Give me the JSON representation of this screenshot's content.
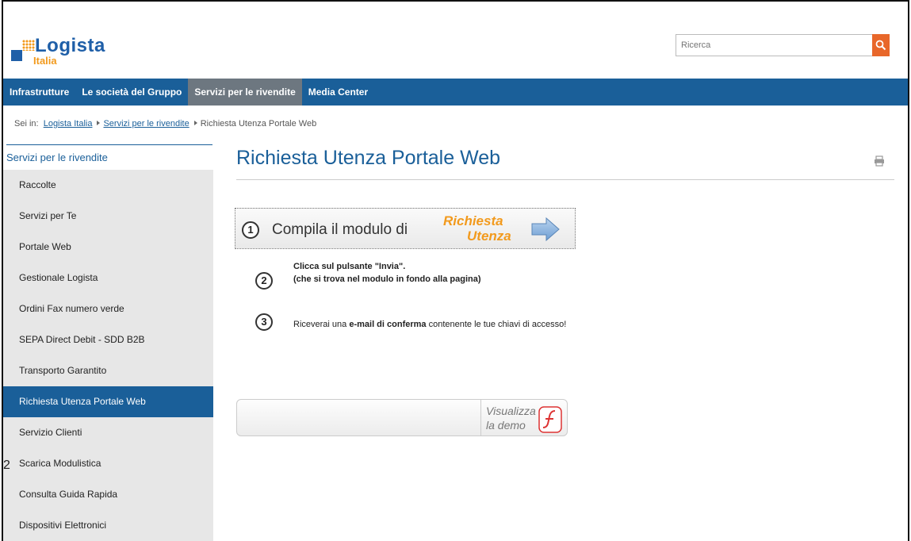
{
  "header": {
    "logo_name": "Logista",
    "logo_sub": "Italia",
    "search_placeholder": "Ricerca"
  },
  "nav": [
    {
      "label": "Infrastrutture"
    },
    {
      "label": "Le società del Gruppo"
    },
    {
      "label": "Servizi per le rivendite",
      "active": true
    },
    {
      "label": "Media Center"
    }
  ],
  "breadcrumb": {
    "prefix": "Sei in:",
    "link1": "Logista Italia",
    "link2": "Servizi per le rivendite",
    "current": "Richiesta Utenza Portale Web"
  },
  "sidebar": {
    "title": "Servizi per le rivendite",
    "items": [
      {
        "label": "Raccolte"
      },
      {
        "label": "Servizi per Te"
      },
      {
        "label": "Portale Web"
      },
      {
        "label": "Gestionale Logista"
      },
      {
        "label": "Ordini Fax numero verde"
      },
      {
        "label": "SEPA Direct Debit - SDD B2B"
      },
      {
        "label": "Transporto Garantito"
      },
      {
        "label": "Richiesta Utenza Portale Web",
        "active": true
      },
      {
        "label": "Servizio Clienti"
      },
      {
        "label": "Scarica Modulistica"
      },
      {
        "label": "Consulta Guida Rapida"
      },
      {
        "label": "Dispositivi Elettronici"
      }
    ]
  },
  "stray_char": "2",
  "main": {
    "title": "Richiesta Utenza Portale Web",
    "step1": {
      "num": "1",
      "text": "Compila il modulo di",
      "highlight1": "Richiesta",
      "highlight2": "Utenza"
    },
    "step2": {
      "num": "2",
      "line1": "Clicca sul pulsante \"Invia\".",
      "line2": "(che si trova nel modulo in fondo alla pagina)"
    },
    "step3": {
      "num": "3",
      "pre": "Riceverai una ",
      "bold": "e-mail di conferma",
      "post": " contenente le tue chiavi di accesso!"
    },
    "demo": {
      "line1": "Visualizza",
      "line2": "la demo"
    }
  },
  "colors": {
    "brand_blue": "#1a5f99",
    "accent_orange": "#f29a1d",
    "search_button": "#e8672a",
    "nav_active": "#6d7780"
  },
  "icons": [
    "search-icon",
    "print-icon",
    "arrow-right-icon",
    "flash-icon",
    "logo-dots-icon"
  ]
}
